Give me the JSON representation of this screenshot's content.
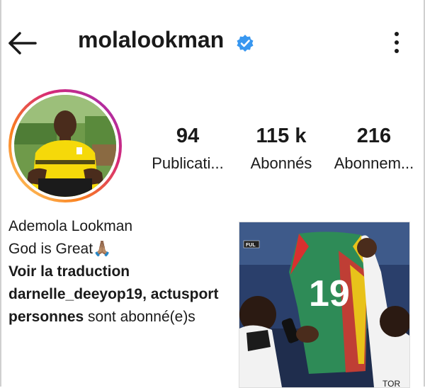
{
  "header": {
    "username": "molalookman"
  },
  "stats": [
    {
      "value": "94",
      "label": "Publicati..."
    },
    {
      "value": "115 k",
      "label": "Abonnés"
    },
    {
      "value": "216",
      "label": "Abonnem..."
    }
  ],
  "bio": {
    "name": "Ademola Lookman",
    "text": "God is Great🙏🏽",
    "translate_link": "Voir la traduction",
    "followed_by_names": "darnelle_deeyop19, actusport",
    "followed_by_tail_bold": "personnes",
    "followed_by_tail": " sont abonné(e)s"
  },
  "media": {
    "jersey_number": "19",
    "channel_badge": "FUL",
    "sponsor_partial": "TOR"
  },
  "colors": {
    "verified": "#3897f0",
    "jersey": "#2e8b57",
    "yellow_shirt": "#f5d90a"
  },
  "icons": {
    "back": "arrow-left-icon",
    "verified": "verified-badge-icon",
    "menu": "more-vertical-icon"
  }
}
